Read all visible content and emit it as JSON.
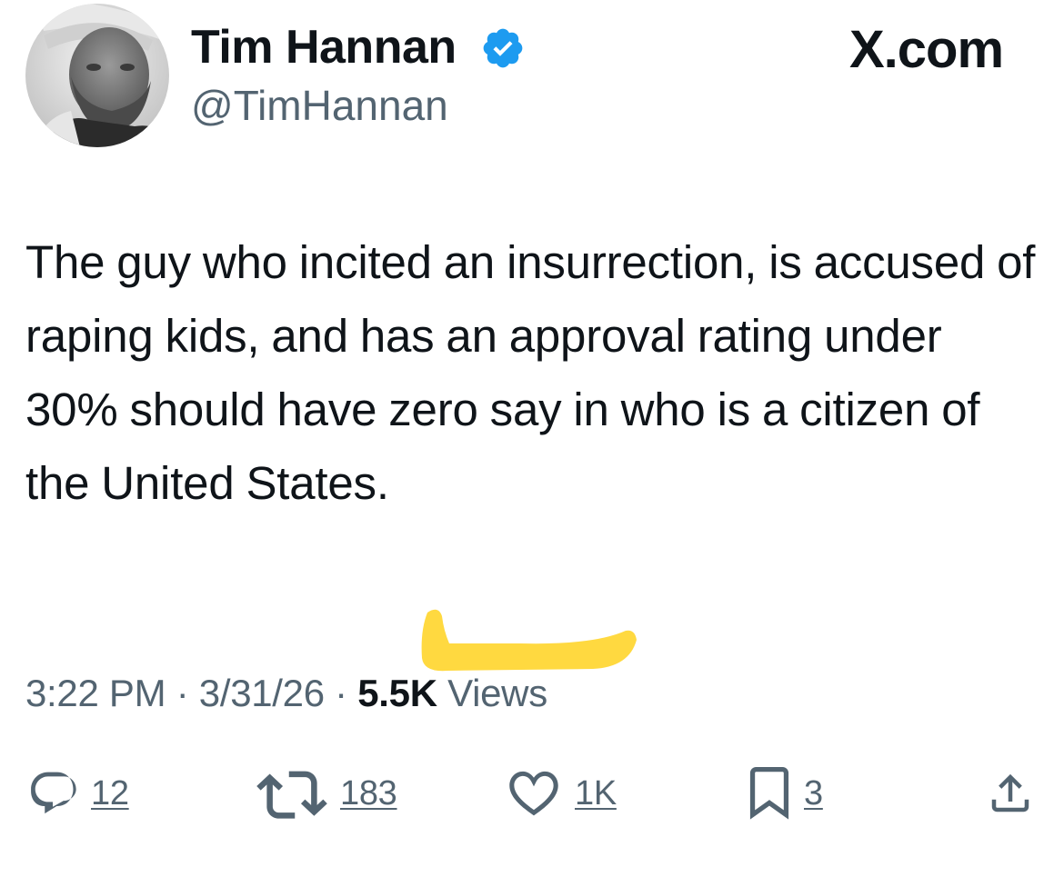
{
  "author": {
    "display_name": "Tim Hannan",
    "handle": "@TimHannan",
    "verified": true
  },
  "site_label": "X.com",
  "tweet": {
    "text": "The guy who incited an insurrection, is accused of raping kids, and has an approval rating under 30% should have zero say in who is a citizen of the United States."
  },
  "meta": {
    "time": "3:22 PM",
    "separator": " · ",
    "date": "3/31/26",
    "views_count": "5.5K",
    "views_label": "Views"
  },
  "actions": {
    "replies": "12",
    "reposts": "183",
    "likes": "1K",
    "bookmarks": "3"
  },
  "colors": {
    "text_primary": "#0f1419",
    "text_secondary": "#536471",
    "verified_badge": "#1d9bf0",
    "highlight_marker": "#ffd21f"
  },
  "icons": {
    "reply": "reply-icon",
    "repost": "repost-icon",
    "like": "heart-icon",
    "bookmark": "bookmark-icon",
    "share": "share-icon",
    "verified": "verified-badge-icon"
  }
}
